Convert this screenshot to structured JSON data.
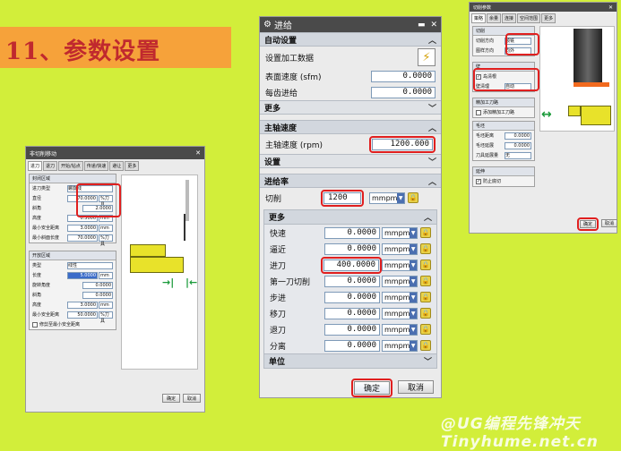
{
  "banner": {
    "title": "11、参数设置"
  },
  "main_dialog": {
    "title": "进给",
    "sections": {
      "auto": {
        "header": "自动设置",
        "settings_label": "设置加工数据",
        "surface_speed_label": "表面速度 (sfm)",
        "surface_speed_value": "0.0000",
        "feed_per_tooth_label": "每齿进给",
        "feed_per_tooth_value": "0.0000",
        "more": "更多"
      },
      "spindle": {
        "header": "主轴速度",
        "speed_label": "主轴速度 (rpm)",
        "speed_value": "1200.000",
        "settings": "设置"
      },
      "feedrate": {
        "header": "进给率",
        "cut_label": "切削",
        "cut_value": "1200",
        "cut_unit": "mmpm",
        "more": "更多",
        "rows": [
          {
            "label": "快速",
            "value": "0.0000",
            "unit": "mmpm"
          },
          {
            "label": "逼近",
            "value": "0.0000",
            "unit": "mmpm"
          },
          {
            "label": "进刀",
            "value": "400.0000",
            "unit": "mmpm"
          },
          {
            "label": "第一刀切削",
            "value": "0.0000",
            "unit": "mmpm"
          },
          {
            "label": "步进",
            "value": "0.0000",
            "unit": "mmpm"
          },
          {
            "label": "移刀",
            "value": "0.0000",
            "unit": "mmpm"
          },
          {
            "label": "退刀",
            "value": "0.0000",
            "unit": "mmpm"
          },
          {
            "label": "分离",
            "value": "0.0000",
            "unit": "mmpm"
          }
        ],
        "unit_section": "单位"
      }
    },
    "ok": "确定",
    "cancel": "取消"
  },
  "left_dialog": {
    "title": "非切削移动",
    "tabs": [
      "进刀",
      "退刀",
      "开始/钻点",
      "传递/快速",
      "避让",
      "更多"
    ],
    "group1": {
      "header": "封闭区域",
      "rows": [
        {
          "label": "进刀类型",
          "value": "螺旋线",
          "unit": ""
        },
        {
          "label": "直径",
          "value": "70.0000",
          "unit": "%刀具"
        },
        {
          "label": "斜角",
          "value": "2.0000",
          "unit": ""
        },
        {
          "label": "高度",
          "value": "0.5000",
          "unit": "mm"
        },
        {
          "label": "最小安全距离",
          "value": "3.0000",
          "unit": "mm"
        },
        {
          "label": "最小斜面长度",
          "value": "70.0000",
          "unit": "%刀具"
        }
      ]
    },
    "group2": {
      "header": "开放区域",
      "rows": [
        {
          "label": "类型",
          "value": "线性",
          "unit": ""
        },
        {
          "label": "长度",
          "value": "5.0000",
          "unit": "mm"
        },
        {
          "label": "旋转角度",
          "value": "0.0000",
          "unit": ""
        },
        {
          "label": "斜角",
          "value": "0.0000",
          "unit": ""
        },
        {
          "label": "高度",
          "value": "3.0000",
          "unit": "mm"
        },
        {
          "label": "最小安全距离",
          "value": "50.0000",
          "unit": "%刀具"
        }
      ],
      "checkbox": "修剪至最小安全距离"
    },
    "ok": "确定",
    "cancel": "取消"
  },
  "right_dialog": {
    "title": "切削参数",
    "tabs": [
      "策略",
      "余量",
      "连接",
      "空间范围",
      "更多"
    ],
    "groups": {
      "cut": {
        "header": "切削",
        "direction_label": "切削方向",
        "direction_value": "顺铣",
        "order_label": "图样方向",
        "order_value": "向外"
      },
      "wall": {
        "header": "壁",
        "checkbox": "岛清根",
        "clean_label": "壁清理",
        "clean_value": "自动"
      },
      "finish": {
        "header": "精加工刀路",
        "checkbox": "添加精加工刀路"
      },
      "blank": {
        "header": "毛坯",
        "dist_label": "毛坯距离",
        "dist_value": "0.0000",
        "depth_label": "毛坯延展",
        "depth_value": "0.0000",
        "tool_label": "刀具延展量",
        "tool_value": "无"
      },
      "extend": {
        "header": "延伸",
        "checkbox": "防止底切"
      }
    },
    "ok": "确定",
    "cancel": "取消"
  },
  "watermark": "@UG编程先锋冲天 Tinyhume.net.cn"
}
